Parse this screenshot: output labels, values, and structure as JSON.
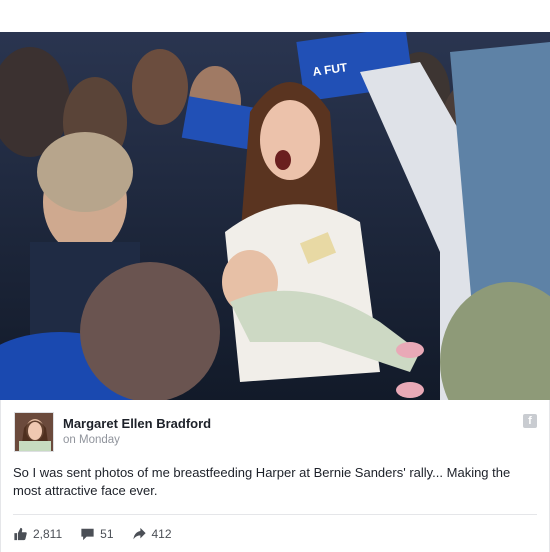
{
  "post": {
    "author_name": "Margaret Ellen Bradford",
    "timestamp": "on Monday",
    "message": "So I was sent photos of me breastfeeding Harper at Bernie Sanders' rally... Making the most attractive face ever.",
    "network_badge": "f"
  },
  "photo": {
    "sign_text": "A FUTURE TO BELIEVE IN",
    "sign_color": "#2150b6"
  },
  "stats": {
    "likes": "2,811",
    "comments": "51",
    "shares": "412",
    "like_icon": "thumbs-up-icon",
    "comment_icon": "comment-icon",
    "share_icon": "share-arrow-icon"
  },
  "colors": {
    "text_primary": "#1d2129",
    "text_secondary": "#90949c",
    "stat_text": "#4b4f56",
    "divider": "#e5e6e9"
  }
}
